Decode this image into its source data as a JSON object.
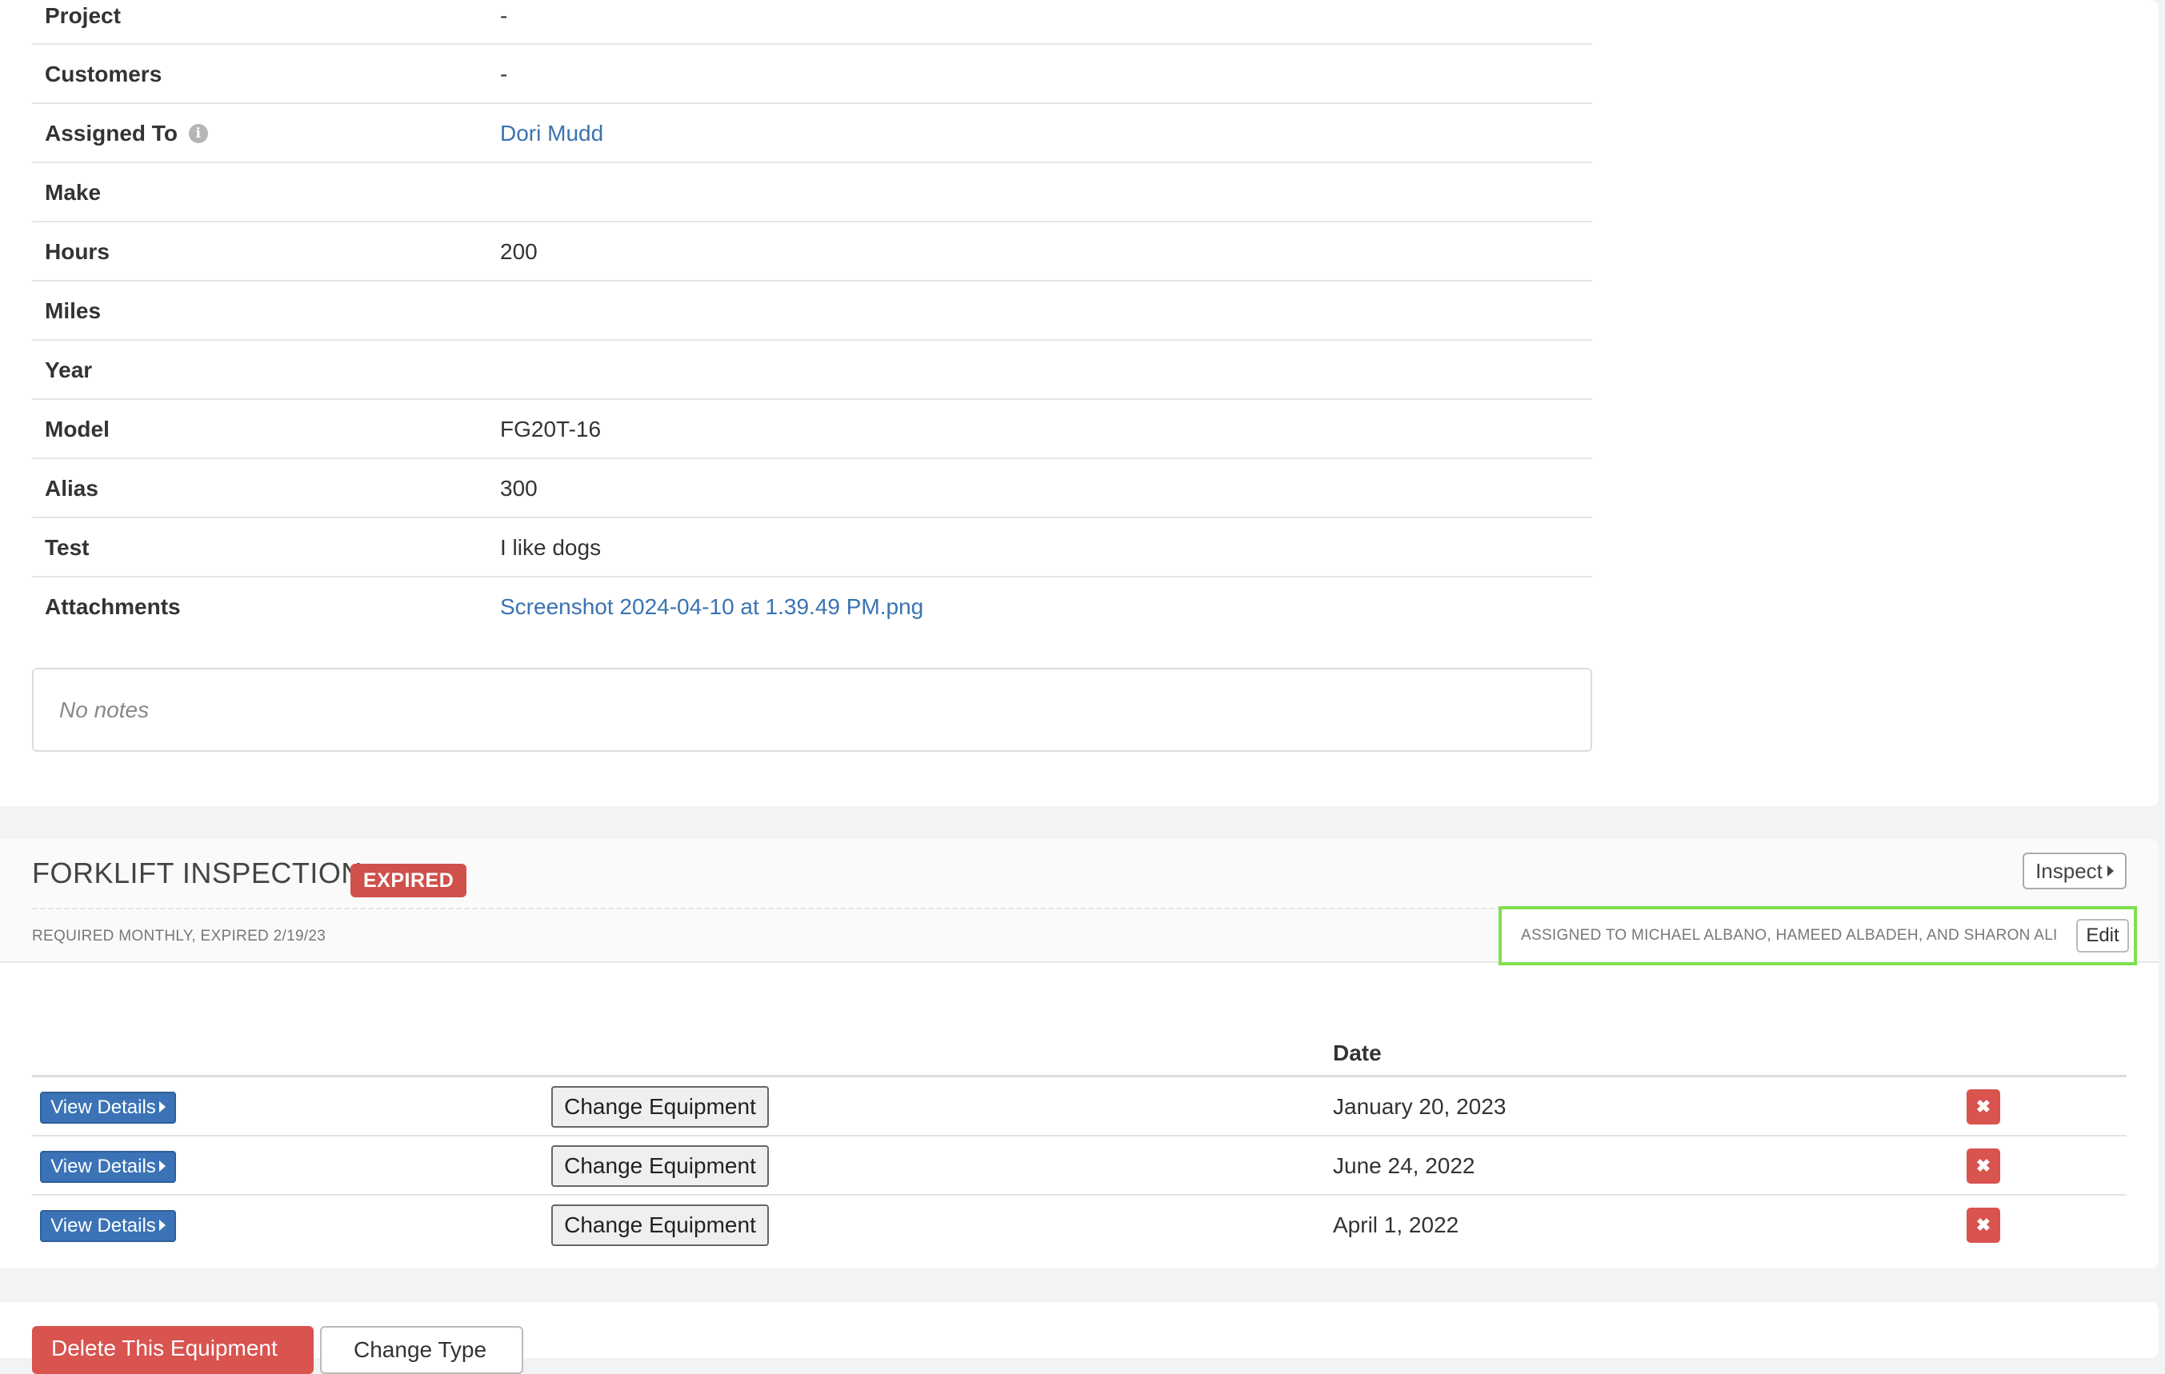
{
  "details": {
    "rows": [
      {
        "label": "Project",
        "value": "-"
      },
      {
        "label": "Customers",
        "value": "-"
      },
      {
        "label": "Assigned To",
        "value": "Dori Mudd"
      },
      {
        "label": "Make",
        "value": ""
      },
      {
        "label": "Hours",
        "value": "200"
      },
      {
        "label": "Miles",
        "value": ""
      },
      {
        "label": "Year",
        "value": ""
      },
      {
        "label": "Model",
        "value": "FG20T-16"
      },
      {
        "label": "Alias",
        "value": "300"
      },
      {
        "label": "Test",
        "value": "I like dogs"
      },
      {
        "label": "Attachments",
        "value": "Screenshot 2024-04-10 at 1.39.49 PM.png"
      }
    ],
    "info_icon_glyph": "i",
    "notes": "No notes"
  },
  "inspection": {
    "title": "FORKLIFT INSPECTION",
    "status_badge": "EXPIRED",
    "status_color": "#d0504c",
    "inspect_label": "Inspect",
    "subtitle": "REQUIRED MONTHLY, EXPIRED 2/19/23",
    "assigned_text": "ASSIGNED TO MICHAEL ALBANO, HAMEED ALBADEH, AND SHARON ALI",
    "edit_label": "Edit",
    "table": {
      "date_header": "Date",
      "view_label": "View Details",
      "change_label": "Change Equipment",
      "delete_glyph": "✖",
      "rows": [
        {
          "date": "January 20, 2023"
        },
        {
          "date": "June 24, 2022"
        },
        {
          "date": "April 1, 2022"
        }
      ]
    }
  },
  "actions": {
    "delete_label": "Delete This Equipment",
    "change_type_label": "Change Type"
  }
}
